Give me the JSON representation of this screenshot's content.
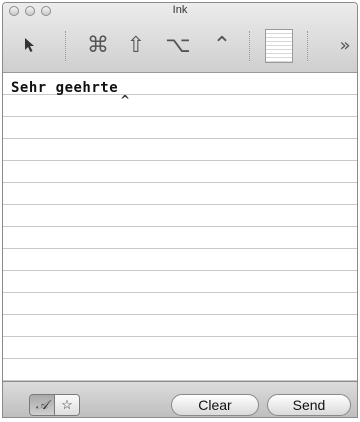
{
  "window": {
    "title": "Ink"
  },
  "toolbar": {
    "pointer_icon": "pointer-icon",
    "command_glyph": "⌘",
    "shift_glyph": "⇧",
    "option_glyph": "⌥",
    "control_glyph": "⌃",
    "overflow_glyph": "»"
  },
  "paper": {
    "ink_text": "Sehr geehrte",
    "caret_glyph": "^"
  },
  "bottombar": {
    "write_mode_glyph": "𝒜",
    "star_glyph": "☆",
    "clear_label": "Clear",
    "send_label": "Send"
  }
}
